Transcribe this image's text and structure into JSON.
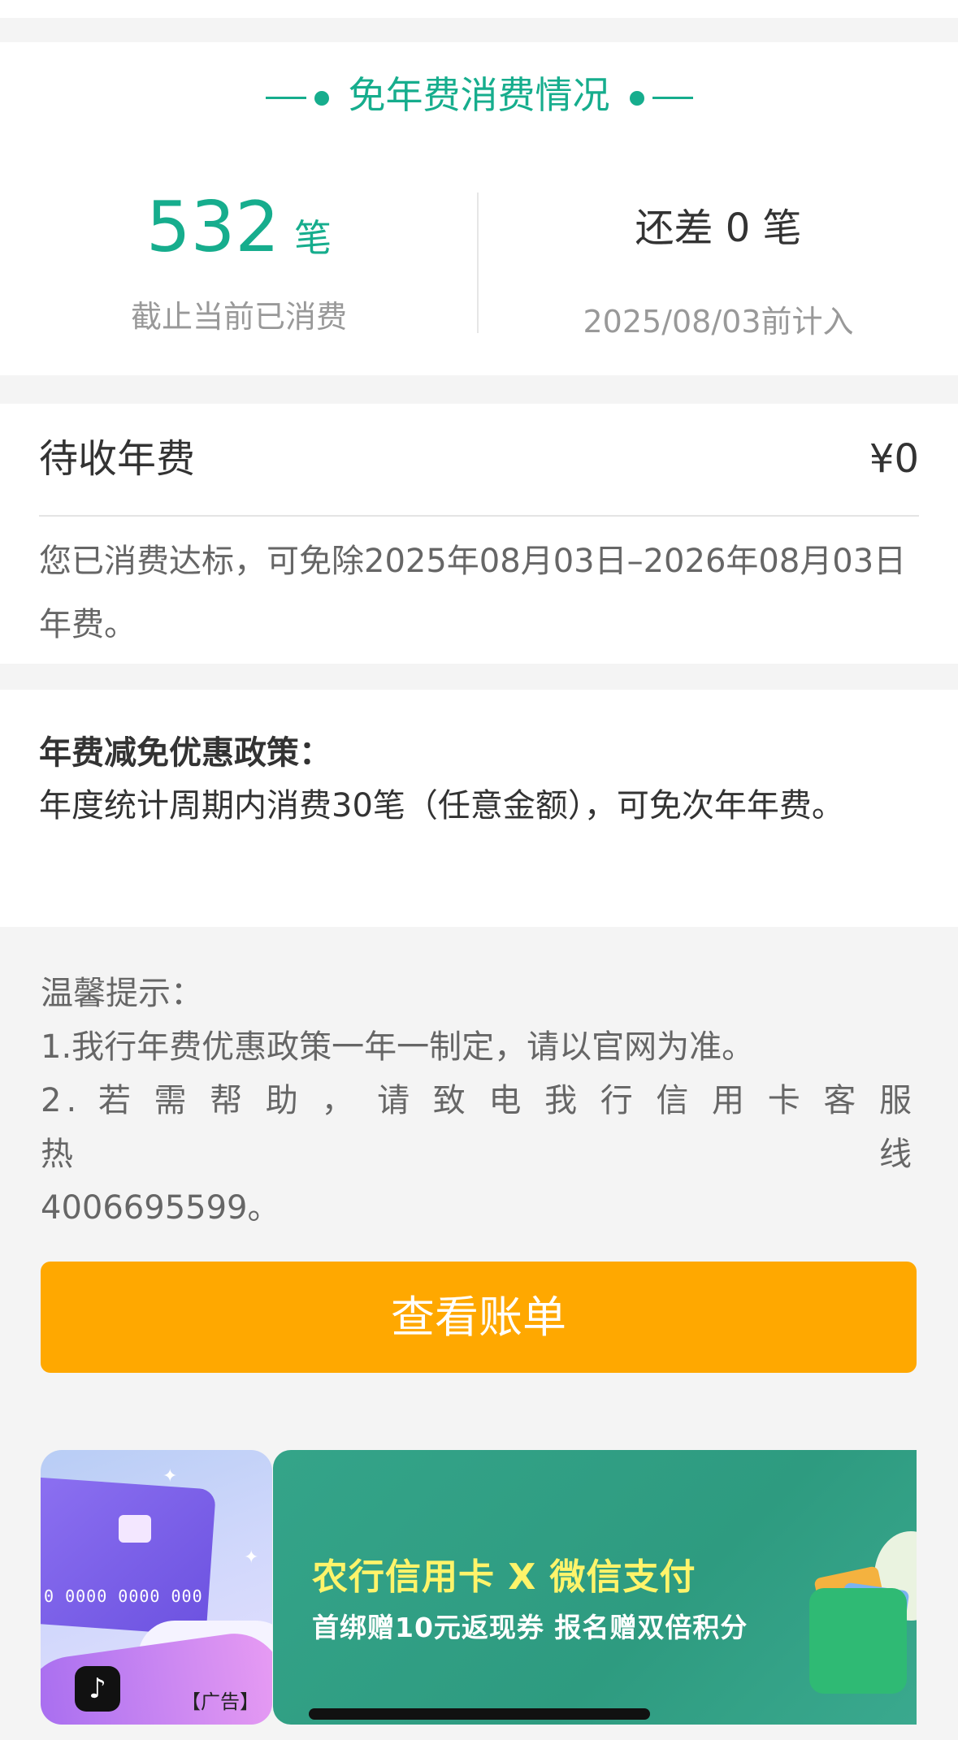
{
  "summary": {
    "title": "免年费消费情况",
    "consumed_count": "532",
    "consumed_unit": "笔",
    "consumed_label": "截止当前已消费",
    "remaining_text": "还差 0 笔",
    "deadline_text": "2025/08/03前计入"
  },
  "fee": {
    "label": "待收年费",
    "value": "¥0",
    "description": "您已消费达标，可免除2025年08月03日–2026年08月03日年费。"
  },
  "policy": {
    "title": "年费减免优惠政策：",
    "body": "年度统计周期内消费30笔（任意金额），可免次年年费。"
  },
  "tips": {
    "heading": "温馨提示：",
    "line1": "1.我行年费优惠政策一年一制定，请以官网为准。",
    "line2a": "2. 若 需 帮 助 ， 请 致 电 我 行 信 用 卡 客 服 热 线",
    "line2b": "4006695599。"
  },
  "actions": {
    "view_bill": "查看账单"
  },
  "ads": {
    "left_tag": "【广告】",
    "left_card_number": "0 0000 0000 000",
    "main_title": "农行信用卡 X 微信支付",
    "main_subtitle": "首绑赠10元返现券 报名赠双倍积分"
  },
  "colors": {
    "accent_green": "#16ad8d",
    "button_orange": "#ffa800",
    "ad_green": "#34a489"
  }
}
